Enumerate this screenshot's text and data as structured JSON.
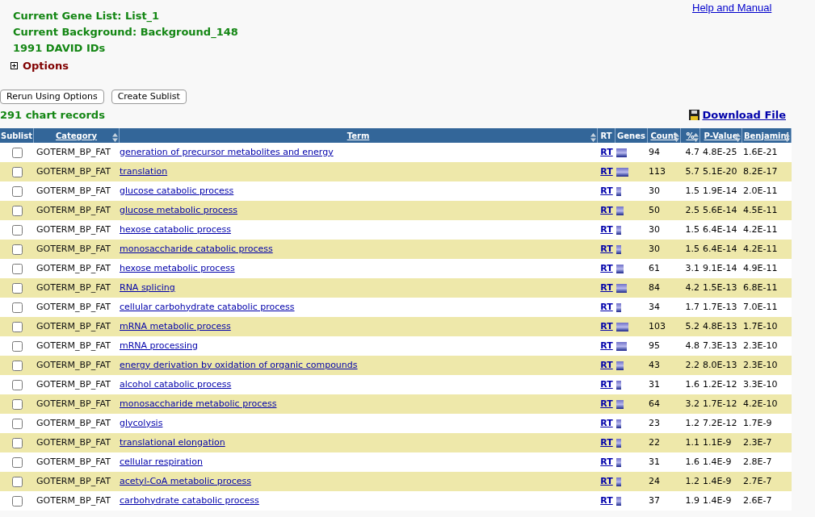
{
  "help_link": "Help and Manual",
  "summary": [
    "Current Gene List: List_1",
    "Current Background: Background_148",
    "1991 DAVID IDs"
  ],
  "options": {
    "label": "Options",
    "expanded": false
  },
  "buttons": [
    "Rerun Using Options",
    "Create Sublist"
  ],
  "records": "291 chart records",
  "download": "Download File",
  "table": {
    "columns": [
      {
        "label": "Sublist",
        "kind": "plain",
        "sortable": false
      },
      {
        "label": "Category",
        "kind": "link",
        "sortable": true
      },
      {
        "label": "Term",
        "kind": "link",
        "sortable": true
      },
      {
        "label": "RT",
        "kind": "plain",
        "sortable": false
      },
      {
        "label": "Genes",
        "kind": "plain",
        "sortable": false
      },
      {
        "label": "Count",
        "kind": "link",
        "sortable": true
      },
      {
        "label": "%",
        "kind": "link",
        "sortable": true
      },
      {
        "label": "P-Value",
        "kind": "link",
        "sortable": true
      },
      {
        "label": "Benjamini",
        "kind": "link",
        "sortable": true
      }
    ],
    "rows": [
      {
        "checked": false,
        "category": "GOTERM_BP_FAT",
        "term": "generation of precursor metabolites and energy",
        "rt": "RT",
        "kind": "large",
        "count": "94",
        "percent": "4.7",
        "p_value": "4.8E-25",
        "benjamini": "1.6E-21"
      },
      {
        "checked": false,
        "category": "GOTERM_BP_FAT",
        "term": "translation",
        "rt": "RT",
        "kind": "xlarge",
        "count": "113",
        "percent": "5.7",
        "p_value": "5.1E-20",
        "benjamini": "8.2E-17"
      },
      {
        "checked": false,
        "category": "GOTERM_BP_FAT",
        "term": "glucose catabolic process",
        "rt": "RT",
        "kind": "small",
        "count": "30",
        "percent": "1.5",
        "p_value": "1.9E-14",
        "benjamini": "2.0E-11"
      },
      {
        "checked": false,
        "category": "GOTERM_BP_FAT",
        "term": "glucose metabolic process",
        "rt": "RT",
        "kind": "medium",
        "count": "50",
        "percent": "2.5",
        "p_value": "5.6E-14",
        "benjamini": "4.5E-11"
      },
      {
        "checked": false,
        "category": "GOTERM_BP_FAT",
        "term": "hexose catabolic process",
        "rt": "RT",
        "kind": "small",
        "count": "30",
        "percent": "1.5",
        "p_value": "6.4E-14",
        "benjamini": "4.2E-11"
      },
      {
        "checked": false,
        "category": "GOTERM_BP_FAT",
        "term": "monosaccharide catabolic process",
        "rt": "RT",
        "kind": "small",
        "count": "30",
        "percent": "1.5",
        "p_value": "6.4E-14",
        "benjamini": "4.2E-11"
      },
      {
        "checked": false,
        "category": "GOTERM_BP_FAT",
        "term": "hexose metabolic process",
        "rt": "RT",
        "kind": "medium",
        "count": "61",
        "percent": "3.1",
        "p_value": "9.1E-14",
        "benjamini": "4.9E-11"
      },
      {
        "checked": false,
        "category": "GOTERM_BP_FAT",
        "term": "RNA splicing",
        "rt": "RT",
        "kind": "large",
        "count": "84",
        "percent": "4.2",
        "p_value": "1.5E-13",
        "benjamini": "6.8E-11"
      },
      {
        "checked": false,
        "category": "GOTERM_BP_FAT",
        "term": "cellular carbohydrate catabolic process",
        "rt": "RT",
        "kind": "small",
        "count": "34",
        "percent": "1.7",
        "p_value": "1.7E-13",
        "benjamini": "7.0E-11"
      },
      {
        "checked": false,
        "category": "GOTERM_BP_FAT",
        "term": "mRNA metabolic process",
        "rt": "RT",
        "kind": "xlarge",
        "count": "103",
        "percent": "5.2",
        "p_value": "4.8E-13",
        "benjamini": "1.7E-10"
      },
      {
        "checked": false,
        "category": "GOTERM_BP_FAT",
        "term": "mRNA processing",
        "rt": "RT",
        "kind": "large",
        "count": "95",
        "percent": "4.8",
        "p_value": "7.3E-13",
        "benjamini": "2.3E-10"
      },
      {
        "checked": false,
        "category": "GOTERM_BP_FAT",
        "term": "energy derivation by oxidation of organic compounds",
        "rt": "RT",
        "kind": "medium",
        "count": "43",
        "percent": "2.2",
        "p_value": "8.0E-13",
        "benjamini": "2.3E-10"
      },
      {
        "checked": false,
        "category": "GOTERM_BP_FAT",
        "term": "alcohol catabolic process",
        "rt": "RT",
        "kind": "small",
        "count": "31",
        "percent": "1.6",
        "p_value": "1.2E-12",
        "benjamini": "3.3E-10"
      },
      {
        "checked": false,
        "category": "GOTERM_BP_FAT",
        "term": "monosaccharide metabolic process",
        "rt": "RT",
        "kind": "medium",
        "count": "64",
        "percent": "3.2",
        "p_value": "1.7E-12",
        "benjamini": "4.2E-10"
      },
      {
        "checked": false,
        "category": "GOTERM_BP_FAT",
        "term": "glycolysis",
        "rt": "RT",
        "kind": "small",
        "count": "23",
        "percent": "1.2",
        "p_value": "7.2E-12",
        "benjamini": "1.7E-9"
      },
      {
        "checked": false,
        "category": "GOTERM_BP_FAT",
        "term": "translational elongation",
        "rt": "RT",
        "kind": "small",
        "count": "22",
        "percent": "1.1",
        "p_value": "1.1E-9",
        "benjamini": "2.3E-7"
      },
      {
        "checked": false,
        "category": "GOTERM_BP_FAT",
        "term": "cellular respiration",
        "rt": "RT",
        "kind": "small",
        "count": "31",
        "percent": "1.6",
        "p_value": "1.4E-9",
        "benjamini": "2.8E-7"
      },
      {
        "checked": false,
        "category": "GOTERM_BP_FAT",
        "term": "acetyl-CoA metabolic process",
        "rt": "RT",
        "kind": "small",
        "count": "24",
        "percent": "1.2",
        "p_value": "1.4E-9",
        "benjamini": "2.7E-7"
      },
      {
        "checked": false,
        "category": "GOTERM_BP_FAT",
        "term": "carbohydrate catabolic process",
        "rt": "RT",
        "kind": "small",
        "count": "37",
        "percent": "1.9",
        "p_value": "1.4E-9",
        "benjamini": "2.6E-7"
      }
    ]
  }
}
